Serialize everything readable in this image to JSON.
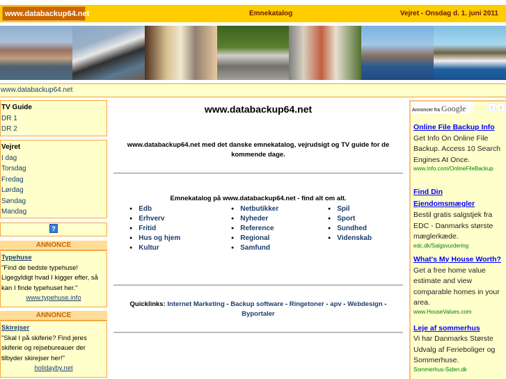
{
  "header": {
    "logo": "www.databackup64.net",
    "catalog_link": "Emnekatalog",
    "weather_date": "Vejret - Onsdag d. 1. juni 2011"
  },
  "breadcrumb": "www.databackup64.net",
  "sidebar": {
    "tv": {
      "title": "TV Guide",
      "items": [
        "DR 1",
        "DR 2"
      ]
    },
    "weather": {
      "title": "Vejret",
      "items": [
        "I dag",
        "Torsdag",
        "Fredag",
        "Lørdag",
        "Søndag",
        "Mandag"
      ]
    },
    "help_icon": "?",
    "ads": [
      {
        "header": "ANNONCE",
        "title": "Typehuse",
        "text": "\"Find de bedste typehuse! Ligegyldigt hvad I kigger efter, så kan I finde typehuset her.\"",
        "url": "www.typehuse.info"
      },
      {
        "header": "ANNONCE",
        "title": "Skirejser",
        "text": "\"Skal I på skiferie? Find jeres skiferie og rejsebureauer der tilbyder skirejser her!\"",
        "url": "holidayby.net"
      }
    ]
  },
  "main": {
    "title": "www.databackup64.net",
    "intro": "www.databackup64.net med det danske emnekatalog, vejrudsigt og TV guide for de kommende dage.",
    "catalog_title": "Emnekatalog på www.databackup64.net - find alt om alt.",
    "columns": [
      [
        "Edb",
        "Erhverv",
        "Fritid",
        "Hus og hjem",
        "Kultur"
      ],
      [
        "Netbutikker",
        "Nyheder",
        "Reference",
        "Regional",
        "Samfund"
      ],
      [
        "Spil",
        "Sport",
        "Sundhed",
        "Videnskab"
      ]
    ],
    "quicklinks_label": "Quicklinks:",
    "quicklinks": [
      "Internet Marketing",
      "Backup software",
      "Ringetoner",
      "apv",
      "Webdesign",
      "Byportaler"
    ]
  },
  "google_ads": {
    "label": "Annoncer fra",
    "brand": "Google",
    "ads": [
      {
        "title": "Online File Backup Info",
        "text": "Get Info On Online File Backup. Access 10 Search Engines At Once.",
        "url": "www.Info.com/OnlineFileBackup"
      },
      {
        "title": "Find Din Ejendomsmægler",
        "text": "Bestil gratis salgstjek fra EDC - Danmarks største mæglerkæde.",
        "url": "edc.dk/Salgsvurdering"
      },
      {
        "title": "What's My House Worth?",
        "text": "Get a free home value estimate and view comparable homes in your area.",
        "url": "www.HouseValues.com"
      },
      {
        "title": "Leje af sommerhus",
        "text": "Vi har Danmarks Største Udvalg af Ferieboliger og Sommerhuse.",
        "url": "Sommerhus-Siden.dk"
      }
    ]
  }
}
